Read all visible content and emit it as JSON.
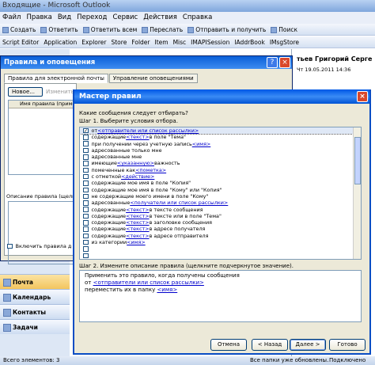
{
  "window": {
    "title": "Входящие - Microsoft Outlook"
  },
  "menu": [
    "Файл",
    "Правка",
    "Вид",
    "Переход",
    "Сервис",
    "Действия",
    "Справка"
  ],
  "toolbar1": [
    "Создать",
    "",
    "Ответить",
    "Ответить всем",
    "Переслать",
    "",
    "Отправить и получить",
    "Поиск"
  ],
  "toolbar2": [
    "Script Editor",
    "Application",
    "Explorer",
    "Store",
    "Folder",
    "Item",
    "Misc",
    "IMAPISession",
    "IAddrBook",
    "IMsgStore"
  ],
  "reading": {
    "sender": "тьев Григорий Серге",
    "date": "Чт 19.05.2011 14:36"
  },
  "nav": {
    "buttons": [
      "Почта",
      "Календарь",
      "Контакты",
      "Задачи"
    ]
  },
  "status": {
    "left": "Всего элементов: 3",
    "right": "Все папки уже обновлены.",
    "right2": "Подключено"
  },
  "rules": {
    "title": "Правила и оповещения",
    "tabs": [
      "Правила для электронной почты",
      "Управление оповещениями"
    ],
    "new_button": "Новое...",
    "change_button": "Изменить",
    "col_header": "Имя правила (приме",
    "desc_label": "Описание правила (щелк",
    "apply_check": "Включить правила д"
  },
  "wizard": {
    "title": "Мастер правил",
    "question": "Какие сообщения следует отбирать?",
    "step1": "Шаг 1. Выберите условия отбора.",
    "conditions": [
      {
        "checked": true,
        "pre": "от ",
        "link": "<отправители или список рассылки>",
        "post": ""
      },
      {
        "checked": false,
        "pre": "содержащие ",
        "link": "<текст>",
        "post": " в поле \"Тема\""
      },
      {
        "checked": false,
        "pre": "при получении через учетную запись ",
        "link": "<имя>",
        "post": ""
      },
      {
        "checked": false,
        "pre": "адресованные только мне",
        "link": "",
        "post": ""
      },
      {
        "checked": false,
        "pre": "адресованные мне",
        "link": "",
        "post": ""
      },
      {
        "checked": false,
        "pre": "имеющие ",
        "link": "<указанную>",
        "post": " важность"
      },
      {
        "checked": false,
        "pre": "помеченные как ",
        "link": "<пометка>",
        "post": ""
      },
      {
        "checked": false,
        "pre": "с отметкой ",
        "link": "<действие>",
        "post": ""
      },
      {
        "checked": false,
        "pre": "содержащие мое имя в поле \"Копия\"",
        "link": "",
        "post": ""
      },
      {
        "checked": false,
        "pre": "содержащие мое имя в поле \"Кому\" или \"Копия\"",
        "link": "",
        "post": ""
      },
      {
        "checked": false,
        "pre": "не содержащие моего имени в поле \"Кому\"",
        "link": "",
        "post": ""
      },
      {
        "checked": false,
        "pre": "адресованные ",
        "link": "<получатели или список рассылки>",
        "post": ""
      },
      {
        "checked": false,
        "pre": "содержащие ",
        "link": "<текст>",
        "post": " в тексте сообщения"
      },
      {
        "checked": false,
        "pre": "содержащие ",
        "link": "<текст>",
        "post": " в тексте или в поле \"Тема\""
      },
      {
        "checked": false,
        "pre": "содержащие ",
        "link": "<текст>",
        "post": " в заголовке сообщения"
      },
      {
        "checked": false,
        "pre": "содержащие ",
        "link": "<текст>",
        "post": " в адресе получателя"
      },
      {
        "checked": false,
        "pre": "содержащие ",
        "link": "<текст>",
        "post": " в адресе отправителя"
      },
      {
        "checked": false,
        "pre": "из категории ",
        "link": "<имя>",
        "post": ""
      },
      {
        "checked": false,
        "pre": "",
        "link": "",
        "post": ""
      },
      {
        "checked": false,
        "pre": "",
        "link": "",
        "post": ""
      }
    ],
    "step2": "Шаг 2. Измените описание правила (щелкните подчеркнутое значение).",
    "description": {
      "line1": "Применить это правило, когда получены сообщения",
      "line2_pre": "от ",
      "line2_link": "<отправители или список рассылки>",
      "line3_pre": "переместить их в папку ",
      "line3_link": "<имя>"
    },
    "buttons": {
      "cancel": "Отмена",
      "back": "< Назад",
      "next": "Далее >",
      "finish": "Готово"
    }
  }
}
